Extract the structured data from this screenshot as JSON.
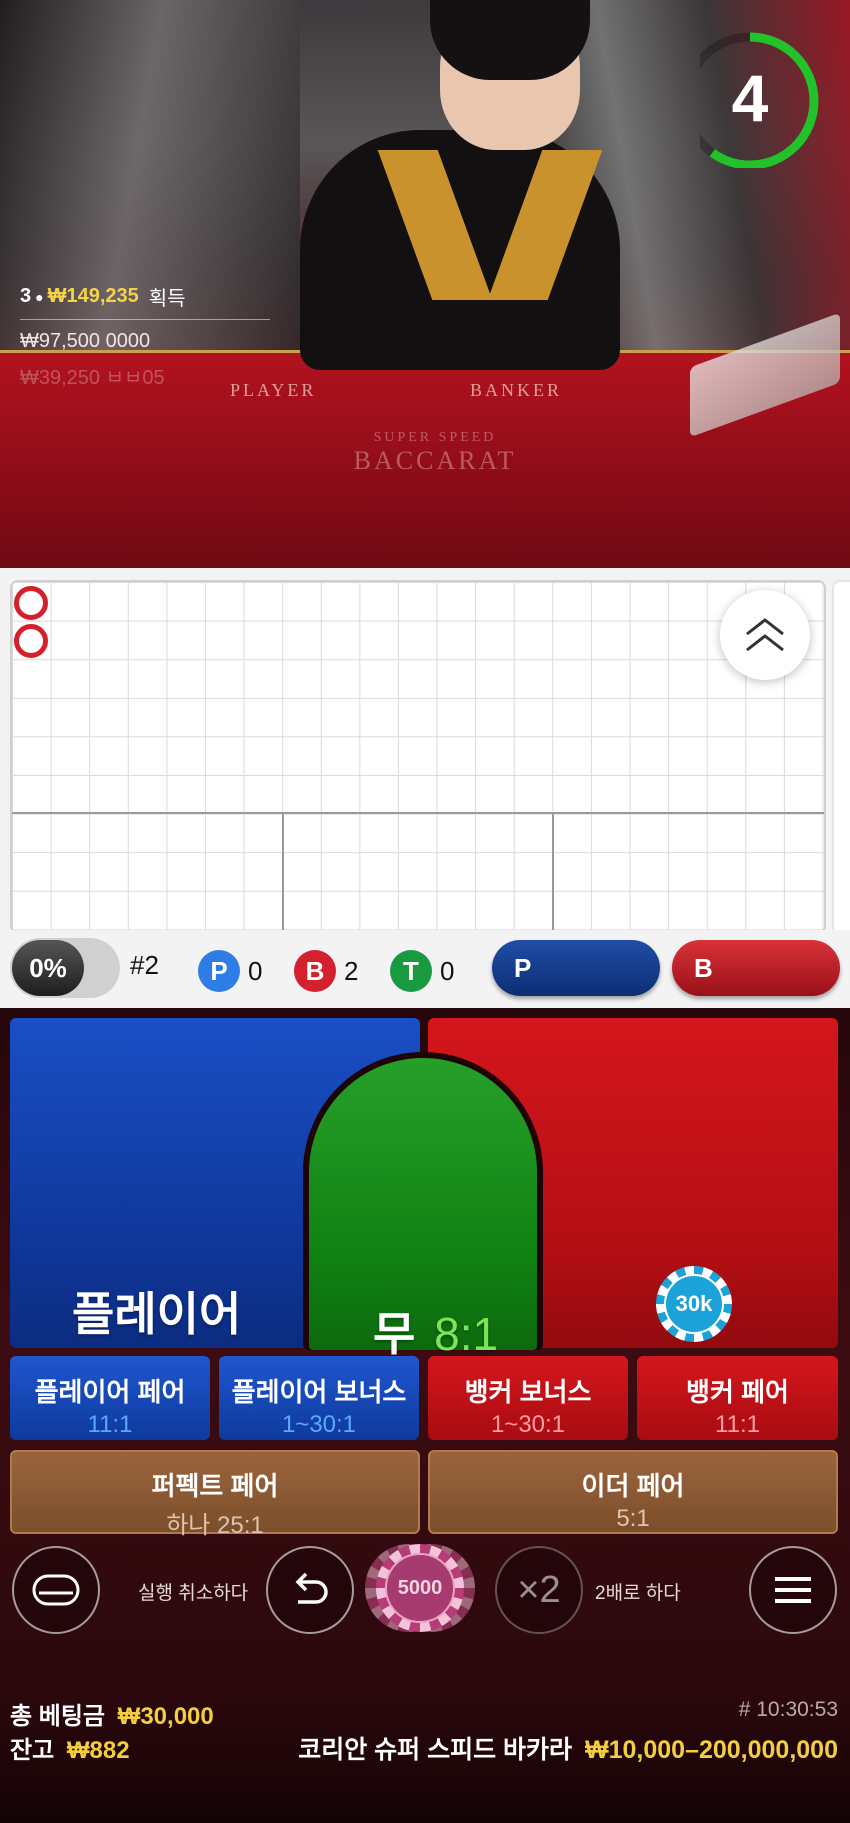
{
  "stream": {
    "countdown": "4",
    "countdown_fraction": 0.6,
    "winners": {
      "count": "3",
      "amount": "₩149,235",
      "suffix": "획득",
      "line2": "₩97,500  0000",
      "line3": "₩39,250  ㅂㅂ05"
    },
    "table_text_player": "PLAYER",
    "table_text_banker": "BANKER",
    "brand_top": "SUPER SPEED",
    "brand_bottom": "BACCARAT"
  },
  "stats": {
    "percent": "0%",
    "round": "#2",
    "player_letter": "P",
    "player_count": "0",
    "banker_letter": "B",
    "banker_count": "2",
    "tie_letter": "T",
    "tie_count": "0",
    "predict_player": "P",
    "predict_banker": "B"
  },
  "bets": {
    "player": "플레이어",
    "tie": "무",
    "tie_odds": "8:1",
    "chip_on_banker": "30k",
    "player_pair": "플레이어 페어",
    "player_pair_odds": "11:1",
    "player_bonus": "플레이어 보너스",
    "player_bonus_odds": "1~30:1",
    "banker_bonus": "뱅커 보너스",
    "banker_bonus_odds": "1~30:1",
    "banker_pair": "뱅커 페어",
    "banker_pair_odds": "11:1",
    "perfect_pair": "퍼펙트 페어",
    "perfect_pair_odds": "하나 25:1",
    "either_pair": "이더 페어",
    "either_pair_odds": "5:1"
  },
  "controls": {
    "undo_label": "실행 취소하다",
    "chip_value": "5000",
    "double_symbol": "×2",
    "double_label": "2배로 하다"
  },
  "footer": {
    "total_bet_label": "총 베팅금",
    "total_bet_value": "₩30,000",
    "balance_label": "잔고",
    "balance_value": "₩882",
    "time": "# 10:30:53",
    "table_name": "코리안 슈퍼 스피드 바카라",
    "table_limits": "₩10,000–200,000,000"
  },
  "colors": {
    "player_blue": "#1a4fc6",
    "banker_red": "#d4161c",
    "tie_green": "#26a02a",
    "gold": "#f3cf3f",
    "timer_green": "#22c22a"
  }
}
